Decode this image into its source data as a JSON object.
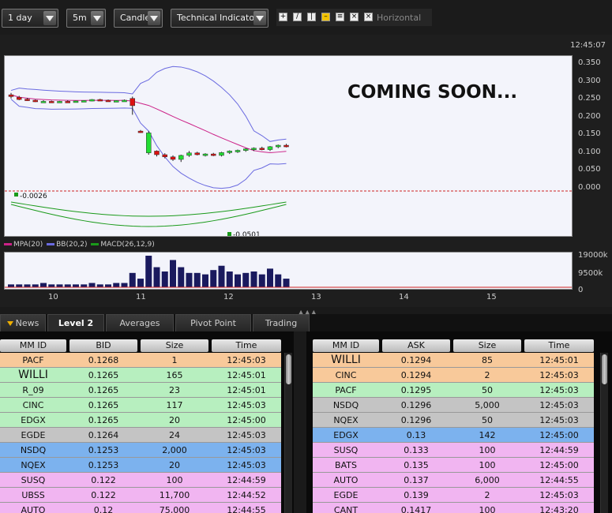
{
  "toolbar": {
    "period": "1 day",
    "interval": "5m",
    "chart_type": "Candle",
    "indicators": "Technical Indicators",
    "draw_label": "Horizontal"
  },
  "clock": "12:45:07",
  "overlay_text": "COMING SOON...",
  "chart_data": {
    "type": "line",
    "y_ticks": [
      "0.350",
      "0.300",
      "0.250",
      "0.200",
      "0.150",
      "0.100",
      "0.050",
      "0.000"
    ],
    "ylim": [
      0,
      0.35
    ],
    "x_ticks": [
      "10",
      "11",
      "12",
      "13",
      "14",
      "15"
    ],
    "legend": [
      "MPA(20)",
      "BB(20,2)",
      "MACD(26,12,9)"
    ],
    "macd_labels": [
      "-0.0026",
      "-0.0501"
    ],
    "volume_ticks": [
      "19000k",
      "9500k",
      "0"
    ],
    "candles": [
      [
        0.26,
        0.27,
        0.255,
        0.265,
        0
      ],
      [
        0.258,
        0.262,
        0.25,
        0.252,
        0
      ],
      [
        0.253,
        0.256,
        0.248,
        0.25,
        0
      ],
      [
        0.25,
        0.252,
        0.245,
        0.246,
        0
      ],
      [
        0.246,
        0.25,
        0.244,
        0.247,
        1
      ],
      [
        0.247,
        0.249,
        0.244,
        0.245,
        0
      ],
      [
        0.245,
        0.248,
        0.243,
        0.247,
        1
      ],
      [
        0.247,
        0.25,
        0.245,
        0.246,
        0
      ],
      [
        0.246,
        0.249,
        0.244,
        0.248,
        1
      ],
      [
        0.248,
        0.25,
        0.246,
        0.249,
        1
      ],
      [
        0.249,
        0.253,
        0.247,
        0.252,
        1
      ],
      [
        0.252,
        0.254,
        0.249,
        0.25,
        0
      ],
      [
        0.25,
        0.252,
        0.247,
        0.248,
        0
      ],
      [
        0.248,
        0.25,
        0.246,
        0.249,
        1
      ],
      [
        0.249,
        0.252,
        0.247,
        0.25,
        1
      ],
      [
        0.255,
        0.26,
        0.21,
        0.235,
        0
      ],
      [
        0.165,
        0.168,
        0.16,
        0.163,
        0
      ],
      [
        0.105,
        0.165,
        0.1,
        0.16,
        1
      ],
      [
        0.11,
        0.112,
        0.095,
        0.1,
        0
      ],
      [
        0.1,
        0.104,
        0.09,
        0.094,
        0
      ],
      [
        0.094,
        0.098,
        0.083,
        0.087,
        0
      ],
      [
        0.087,
        0.1,
        0.08,
        0.098,
        1
      ],
      [
        0.098,
        0.11,
        0.094,
        0.105,
        1
      ],
      [
        0.105,
        0.108,
        0.098,
        0.1,
        0
      ],
      [
        0.1,
        0.104,
        0.095,
        0.102,
        1
      ],
      [
        0.102,
        0.105,
        0.096,
        0.098,
        0
      ],
      [
        0.098,
        0.108,
        0.095,
        0.106,
        1
      ],
      [
        0.106,
        0.112,
        0.102,
        0.11,
        1
      ],
      [
        0.11,
        0.114,
        0.105,
        0.112,
        1
      ],
      [
        0.112,
        0.118,
        0.108,
        0.116,
        1
      ],
      [
        0.116,
        0.12,
        0.11,
        0.118,
        1
      ],
      [
        0.118,
        0.122,
        0.112,
        0.114,
        0
      ],
      [
        0.114,
        0.124,
        0.11,
        0.122,
        1
      ],
      [
        0.122,
        0.128,
        0.118,
        0.126,
        1
      ],
      [
        0.126,
        0.13,
        0.12,
        0.125,
        0
      ]
    ],
    "volume": [
      2,
      2,
      2,
      2,
      3,
      2,
      2,
      2,
      2,
      2,
      3,
      2,
      2,
      3,
      3,
      10,
      6,
      22,
      14,
      11,
      19,
      14,
      10,
      10,
      9,
      12,
      15,
      11,
      9,
      10,
      11,
      9,
      13,
      9,
      6
    ]
  },
  "tabs": [
    "News",
    "Level 2",
    "Averages",
    "Pivot Point",
    "Trading"
  ],
  "bid_table": {
    "headers": [
      "MM ID",
      "BID",
      "Size",
      "Time"
    ],
    "rows": [
      {
        "mm": "PACF",
        "price": "0.1268",
        "size": "1",
        "time": "12:45:03",
        "color": "#f8c99a"
      },
      {
        "mm": "WILLI",
        "price": "0.1265",
        "size": "165",
        "time": "12:45:01",
        "color": "#b7efbf"
      },
      {
        "mm": "R_09",
        "price": "0.1265",
        "size": "23",
        "time": "12:45:01",
        "color": "#b7efbf"
      },
      {
        "mm": "CINC",
        "price": "0.1265",
        "size": "117",
        "time": "12:45:03",
        "color": "#b7efbf"
      },
      {
        "mm": "EDGX",
        "price": "0.1265",
        "size": "20",
        "time": "12:45:00",
        "color": "#b7efbf"
      },
      {
        "mm": "EGDE",
        "price": "0.1264",
        "size": "24",
        "time": "12:45:03",
        "color": "#c4c4c4"
      },
      {
        "mm": "NSDQ",
        "price": "0.1253",
        "size": "2,000",
        "time": "12:45:03",
        "color": "#7cb2ee"
      },
      {
        "mm": "NQEX",
        "price": "0.1253",
        "size": "20",
        "time": "12:45:03",
        "color": "#7cb2ee"
      },
      {
        "mm": "SUSQ",
        "price": "0.122",
        "size": "100",
        "time": "12:44:59",
        "color": "#f1b5f1"
      },
      {
        "mm": "UBSS",
        "price": "0.122",
        "size": "11,700",
        "time": "12:44:52",
        "color": "#f1b5f1"
      },
      {
        "mm": "AUTO",
        "price": "0.12",
        "size": "75,000",
        "time": "12:44:55",
        "color": "#f1b5f1"
      }
    ]
  },
  "ask_table": {
    "headers": [
      "MM ID",
      "ASK",
      "Size",
      "Time"
    ],
    "rows": [
      {
        "mm": "WILLI",
        "price": "0.1294",
        "size": "85",
        "time": "12:45:01",
        "color": "#f8c99a"
      },
      {
        "mm": "CINC",
        "price": "0.1294",
        "size": "2",
        "time": "12:45:03",
        "color": "#f8c99a"
      },
      {
        "mm": "PACF",
        "price": "0.1295",
        "size": "50",
        "time": "12:45:03",
        "color": "#b7efbf"
      },
      {
        "mm": "NSDQ",
        "price": "0.1296",
        "size": "5,000",
        "time": "12:45:03",
        "color": "#c4c4c4"
      },
      {
        "mm": "NQEX",
        "price": "0.1296",
        "size": "50",
        "time": "12:45:03",
        "color": "#c4c4c4"
      },
      {
        "mm": "EDGX",
        "price": "0.13",
        "size": "142",
        "time": "12:45:00",
        "color": "#7cb2ee"
      },
      {
        "mm": "SUSQ",
        "price": "0.133",
        "size": "100",
        "time": "12:44:59",
        "color": "#f1b5f1"
      },
      {
        "mm": "BATS",
        "price": "0.135",
        "size": "100",
        "time": "12:45:00",
        "color": "#f1b5f1"
      },
      {
        "mm": "AUTO",
        "price": "0.137",
        "size": "6,000",
        "time": "12:44:55",
        "color": "#f1b5f1"
      },
      {
        "mm": "EGDE",
        "price": "0.139",
        "size": "2",
        "time": "12:45:03",
        "color": "#f1b5f1"
      },
      {
        "mm": "CANT",
        "price": "0.1417",
        "size": "100",
        "time": "12:43:20",
        "color": "#f1b5f1"
      }
    ]
  }
}
